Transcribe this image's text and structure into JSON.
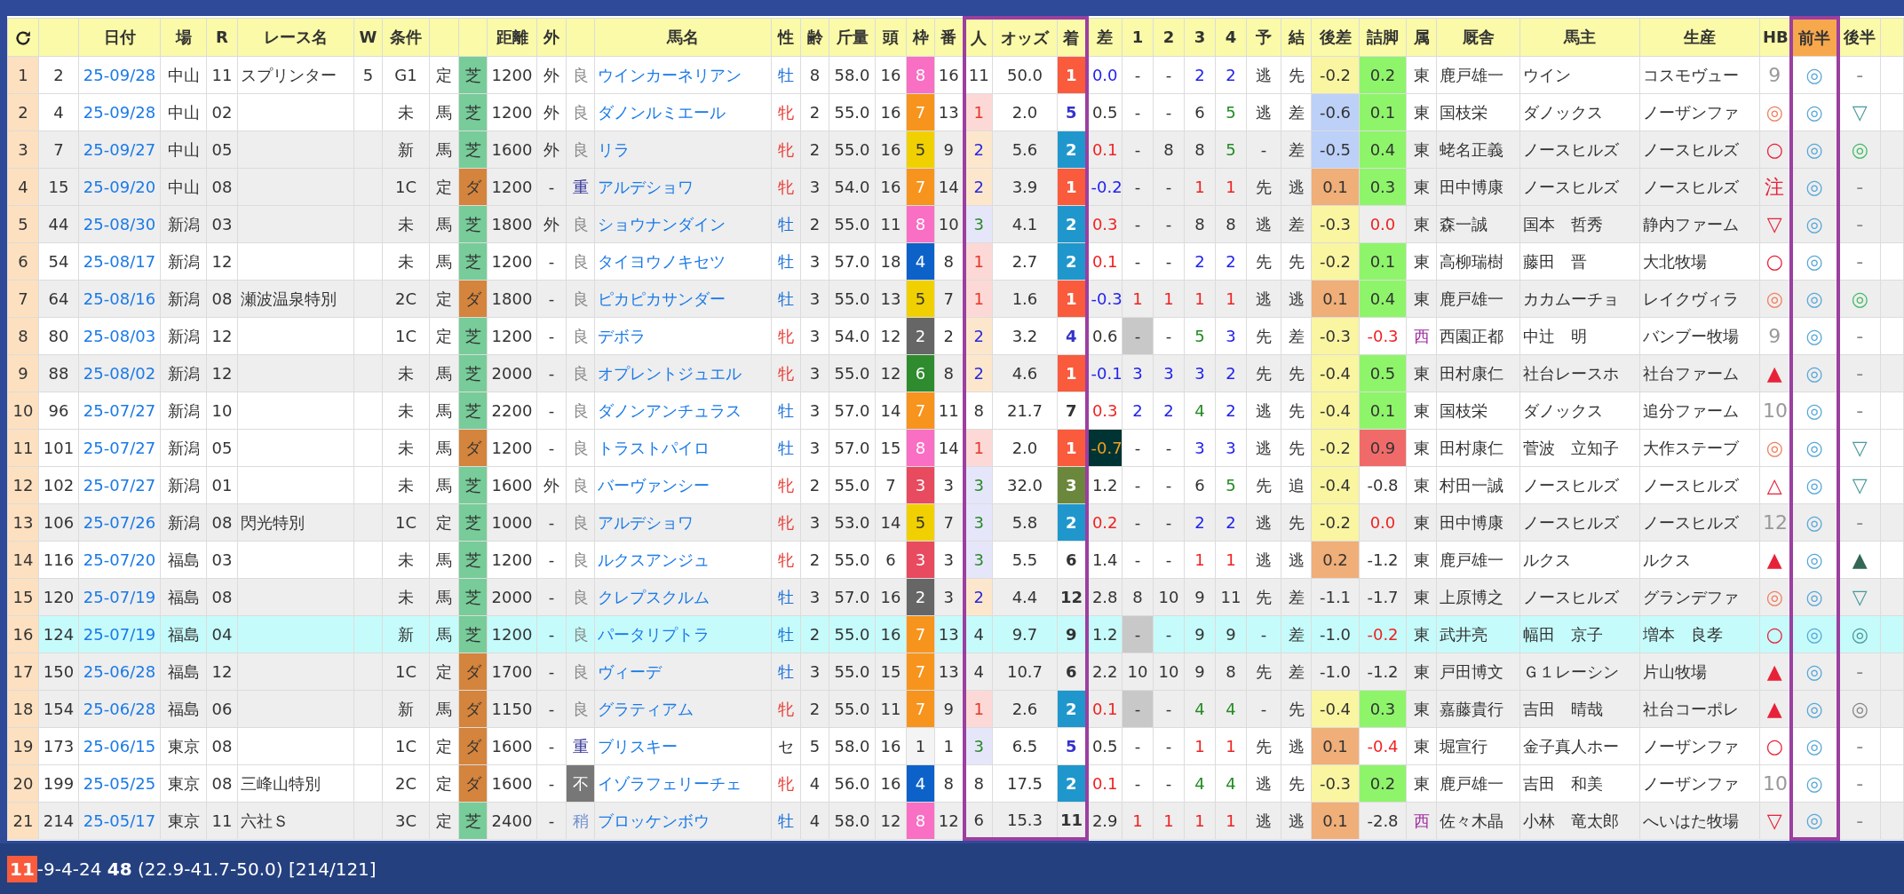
{
  "columns": [
    {
      "kind": "refresh"
    },
    {},
    {
      "label": "日付",
      "kind": "link"
    },
    {
      "label": "場"
    },
    {
      "label": "R"
    },
    {
      "label": "レース名"
    },
    {
      "label": "W"
    },
    {
      "label": "条件"
    },
    {},
    {},
    {
      "label": "距離"
    },
    {
      "label": "外"
    },
    {},
    {
      "label": "馬名",
      "kind": "link"
    },
    {
      "label": "性"
    },
    {
      "label": "齢"
    },
    {
      "label": "斤量"
    },
    {
      "label": "頭"
    },
    {
      "label": "枠"
    },
    {
      "label": "番"
    },
    {
      "label": "人",
      "framed": true
    },
    {
      "label": "オッズ",
      "framed": true
    },
    {
      "label": "着",
      "framed": true
    },
    {
      "label": "差"
    },
    {
      "label": "1"
    },
    {
      "label": "2"
    },
    {
      "label": "3"
    },
    {
      "label": "4"
    },
    {
      "label": "予"
    },
    {
      "label": "結"
    },
    {
      "label": "後差"
    },
    {
      "label": "詰脚"
    },
    {
      "label": "属"
    },
    {
      "label": "厩舎"
    },
    {
      "label": "馬主"
    },
    {
      "label": "生産"
    },
    {
      "label": "HB"
    },
    {
      "label": "前半",
      "framed": true,
      "fill": {
        "color": "#f8a84c"
      }
    },
    {
      "label": "後半"
    }
  ],
  "rows": [
    {
      "selected": false,
      "shaded": false,
      "cells": [
        "1",
        "2",
        "25-09/28",
        "中山",
        "11",
        "スプリンター",
        "5",
        "G1",
        "定",
        {
          "text": "芝",
          "fill": {
            "color": "#77cc99"
          }
        },
        "1200",
        "外",
        {
          "text": "良",
          "color": "#888888"
        },
        "ウインカーネリアン",
        {
          "text": "牡",
          "color": "#1a6fd8"
        },
        "8",
        "58.0",
        "16",
        {
          "text": "8",
          "fill": {
            "color": "#f86fc3"
          }
        },
        "16",
        "11",
        "50.0",
        {
          "text": "1",
          "fill": {
            "color": "#f95b3c"
          }
        },
        {
          "text": "0.0",
          "color": "#2222ee"
        },
        "-",
        "-",
        {
          "text": "2",
          "color": "#2222ee"
        },
        {
          "text": "2",
          "color": "#2222ee"
        },
        "逃",
        "先",
        {
          "text": "-0.2",
          "fill": {
            "color": "#faf5a0"
          }
        },
        {
          "text": "0.2",
          "fill": {
            "color": "#8ef56a"
          }
        },
        "東",
        "鹿戸雄一",
        "ウイン",
        "コスモヴュー",
        {
          "text": "9",
          "color": "#999999"
        },
        {
          "text": "◎",
          "color": "#5aa8d8"
        },
        {
          "text": "-",
          "color": "#888888"
        }
      ]
    },
    {
      "selected": false,
      "shaded": false,
      "cells": [
        "2",
        "4",
        "25-09/28",
        "中山",
        "02",
        null,
        null,
        "未",
        "馬",
        {
          "text": "芝",
          "fill": {
            "color": "#77cc99"
          }
        },
        "1200",
        "外",
        {
          "text": "良",
          "color": "#888888"
        },
        "ダノンルミエール",
        {
          "text": "牝",
          "color": "#e8413a"
        },
        "2",
        "55.0",
        "16",
        {
          "text": "7",
          "fill": {
            "color": "#f7941d"
          }
        },
        "13",
        {
          "text": "1",
          "color": "#e8332a",
          "fill": {
            "color": "#fcd9d6"
          }
        },
        "2.0",
        {
          "text": "5",
          "color": "#3333cc"
        },
        "0.5",
        "-",
        "-",
        "6",
        {
          "text": "5",
          "color": "#228b22"
        },
        "逃",
        "差",
        {
          "text": "-0.6",
          "fill": {
            "color": "#bcd0f8"
          }
        },
        {
          "text": "0.1",
          "fill": {
            "color": "#8ef56a"
          }
        },
        "東",
        "国枝栄",
        "ダノックス",
        "ノーザンファ",
        {
          "text": "◎",
          "color": "#f08060"
        },
        {
          "text": "◎",
          "color": "#5aa8d8"
        },
        {
          "text": "▽",
          "color": "#4a9a9a"
        }
      ]
    },
    {
      "selected": false,
      "shaded": true,
      "cells": [
        "3",
        "7",
        "25-09/27",
        "中山",
        "05",
        null,
        null,
        "新",
        "馬",
        {
          "text": "芝",
          "fill": {
            "color": "#77cc99"
          }
        },
        "1600",
        "外",
        {
          "text": "良",
          "color": "#888888"
        },
        "リラ",
        {
          "text": "牝",
          "color": "#e8413a"
        },
        "2",
        "55.0",
        "16",
        {
          "text": "5",
          "fill": {
            "color": "#f0d000"
          }
        },
        "9",
        {
          "text": "2",
          "color": "#2a2ae0",
          "fill": {
            "color": "#fde7cc"
          }
        },
        "5.6",
        {
          "text": "2",
          "fill": {
            "color": "#1f97cd"
          }
        },
        {
          "text": "0.1",
          "color": "#ee2222"
        },
        "-",
        "8",
        "8",
        {
          "text": "5",
          "color": "#228b22"
        },
        "-",
        "差",
        {
          "text": "-0.5",
          "fill": {
            "color": "#bcd0f8"
          }
        },
        {
          "text": "0.4",
          "fill": {
            "color": "#8ef56a"
          }
        },
        "東",
        "蛯名正義",
        "ノースヒルズ",
        "ノースヒルズ",
        {
          "text": "○",
          "color": "#e8213a"
        },
        {
          "text": "◎",
          "color": "#5aa8d8"
        },
        {
          "text": "◎",
          "color": "#44bb66"
        }
      ]
    },
    {
      "selected": false,
      "shaded": true,
      "cells": [
        "4",
        "15",
        "25-09/20",
        "中山",
        "08",
        null,
        null,
        "1C",
        "定",
        {
          "text": "ダ",
          "fill": {
            "color": "#d4843c"
          }
        },
        "1200",
        "-",
        {
          "text": "重",
          "color": "#333399"
        },
        "アルデショワ",
        {
          "text": "牝",
          "color": "#e8413a"
        },
        "3",
        "54.0",
        "16",
        {
          "text": "7",
          "fill": {
            "color": "#f7941d"
          }
        },
        "14",
        {
          "text": "2",
          "color": "#2a2ae0",
          "fill": {
            "color": "#fde7cc"
          }
        },
        "3.9",
        {
          "text": "1",
          "fill": {
            "color": "#f95b3c"
          }
        },
        {
          "text": "-0.2",
          "color": "#2222ee"
        },
        "-",
        "-",
        {
          "text": "1",
          "color": "#ee2222"
        },
        {
          "text": "1",
          "color": "#ee2222"
        },
        "先",
        "逃",
        {
          "text": "0.1",
          "fill": {
            "color": "#f0ae78"
          }
        },
        {
          "text": "0.3",
          "fill": {
            "color": "#8ef56a"
          }
        },
        "東",
        "田中博康",
        "ノースヒルズ",
        "ノースヒルズ",
        {
          "text": "注",
          "color": "#e8213a"
        },
        {
          "text": "◎",
          "color": "#5aa8d8"
        },
        {
          "text": "-",
          "color": "#888888"
        }
      ]
    },
    {
      "selected": false,
      "shaded": true,
      "cells": [
        "5",
        "44",
        "25-08/30",
        "新潟",
        "03",
        null,
        null,
        "未",
        "馬",
        {
          "text": "芝",
          "fill": {
            "color": "#77cc99"
          }
        },
        "1800",
        "外",
        {
          "text": "良",
          "color": "#888888"
        },
        "ショウナンダイン",
        {
          "text": "牡",
          "color": "#1a6fd8"
        },
        "2",
        "55.0",
        "11",
        {
          "text": "8",
          "fill": {
            "color": "#f86fc3"
          }
        },
        "10",
        {
          "text": "3",
          "color": "#2a8a2a",
          "fill": {
            "color": "#e6e6fa"
          }
        },
        "4.1",
        {
          "text": "2",
          "fill": {
            "color": "#1f97cd"
          }
        },
        {
          "text": "0.3",
          "color": "#ee2222"
        },
        "-",
        "-",
        "8",
        "8",
        "逃",
        "差",
        {
          "text": "-0.3",
          "fill": {
            "color": "#faf5a0"
          }
        },
        {
          "text": "0.0",
          "color": "#ee2222"
        },
        "東",
        "森一誠",
        "国本　哲秀",
        "静内ファーム",
        {
          "text": "▽",
          "color": "#e8213a"
        },
        {
          "text": "◎",
          "color": "#5aa8d8"
        },
        {
          "text": "-",
          "color": "#888888"
        }
      ]
    },
    {
      "selected": false,
      "shaded": false,
      "cells": [
        "6",
        "54",
        "25-08/17",
        "新潟",
        "12",
        null,
        null,
        "未",
        "馬",
        {
          "text": "芝",
          "fill": {
            "color": "#77cc99"
          }
        },
        "1200",
        "-",
        {
          "text": "良",
          "color": "#888888"
        },
        "タイヨウノキセツ",
        {
          "text": "牡",
          "color": "#1a6fd8"
        },
        "3",
        "57.0",
        "18",
        {
          "text": "4",
          "fill": {
            "color": "#0d62c9"
          }
        },
        "8",
        {
          "text": "1",
          "color": "#e8332a",
          "fill": {
            "color": "#fcd9d6"
          }
        },
        "2.7",
        {
          "text": "2",
          "fill": {
            "color": "#1f97cd"
          }
        },
        {
          "text": "0.1",
          "color": "#ee2222"
        },
        "-",
        "-",
        {
          "text": "2",
          "color": "#2222ee"
        },
        {
          "text": "2",
          "color": "#2222ee"
        },
        "先",
        "先",
        {
          "text": "-0.2",
          "fill": {
            "color": "#faf5a0"
          }
        },
        {
          "text": "0.1",
          "fill": {
            "color": "#8ef56a"
          }
        },
        "東",
        "高柳瑞樹",
        "藤田　晋",
        "大北牧場",
        {
          "text": "○",
          "color": "#e8213a"
        },
        {
          "text": "◎",
          "color": "#5aa8d8"
        },
        {
          "text": "-",
          "color": "#888888"
        }
      ]
    },
    {
      "selected": false,
      "shaded": true,
      "cells": [
        "7",
        "64",
        "25-08/16",
        "新潟",
        "08",
        "瀬波温泉特別",
        null,
        "2C",
        "定",
        {
          "text": "ダ",
          "fill": {
            "color": "#d4843c"
          }
        },
        "1800",
        "-",
        {
          "text": "良",
          "color": "#888888"
        },
        "ピカピカサンダー",
        {
          "text": "牡",
          "color": "#1a6fd8"
        },
        "3",
        "55.0",
        "13",
        {
          "text": "5",
          "fill": {
            "color": "#f0d000"
          }
        },
        "7",
        {
          "text": "1",
          "color": "#e8332a",
          "fill": {
            "color": "#fcd9d6"
          }
        },
        "1.6",
        {
          "text": "1",
          "fill": {
            "color": "#f95b3c"
          }
        },
        {
          "text": "-0.3",
          "color": "#2222ee"
        },
        {
          "text": "1",
          "color": "#ee2222"
        },
        {
          "text": "1",
          "color": "#ee2222"
        },
        {
          "text": "1",
          "color": "#ee2222"
        },
        {
          "text": "1",
          "color": "#ee2222"
        },
        "逃",
        "逃",
        {
          "text": "0.1",
          "fill": {
            "color": "#f0ae78"
          }
        },
        {
          "text": "0.4",
          "fill": {
            "color": "#8ef56a"
          }
        },
        "東",
        "鹿戸雄一",
        "カカムーチョ",
        "レイクヴィラ",
        {
          "text": "◎",
          "color": "#f08060"
        },
        {
          "text": "◎",
          "color": "#5aa8d8"
        },
        {
          "text": "◎",
          "color": "#44bb66"
        }
      ]
    },
    {
      "selected": false,
      "shaded": false,
      "cells": [
        "8",
        "80",
        "25-08/03",
        "新潟",
        "12",
        null,
        null,
        "1C",
        "定",
        {
          "text": "芝",
          "fill": {
            "color": "#77cc99"
          }
        },
        "1200",
        "-",
        {
          "text": "良",
          "color": "#888888"
        },
        "デボラ",
        {
          "text": "牝",
          "color": "#e8413a"
        },
        "3",
        "54.0",
        "12",
        {
          "text": "2",
          "fill": {
            "color": "#666666"
          }
        },
        "2",
        {
          "text": "2",
          "color": "#2a2ae0",
          "fill": {
            "color": "#fde7cc"
          }
        },
        "3.2",
        {
          "text": "4",
          "color": "#3333cc"
        },
        "0.6",
        {
          "text": "-",
          "fill": {
            "color": "#c8c8c8"
          }
        },
        "-",
        {
          "text": "5",
          "color": "#228b22"
        },
        {
          "text": "3",
          "color": "#2222ee"
        },
        "先",
        "差",
        {
          "text": "-0.3",
          "fill": {
            "color": "#faf5a0"
          }
        },
        {
          "text": "-0.3",
          "color": "#ee2222"
        },
        {
          "text": "西",
          "color": "#a030a0"
        },
        "西園正都",
        "中辻　明",
        "バンブー牧場",
        {
          "text": "9",
          "color": "#999999"
        },
        {
          "text": "◎",
          "color": "#5aa8d8"
        },
        {
          "text": "-",
          "color": "#888888"
        }
      ]
    },
    {
      "selected": false,
      "shaded": true,
      "cells": [
        "9",
        "88",
        "25-08/02",
        "新潟",
        "12",
        null,
        null,
        "未",
        "馬",
        {
          "text": "芝",
          "fill": {
            "color": "#77cc99"
          }
        },
        "2000",
        "-",
        {
          "text": "良",
          "color": "#888888"
        },
        "オプレントジュエル",
        {
          "text": "牝",
          "color": "#e8413a"
        },
        "3",
        "55.0",
        "12",
        {
          "text": "6",
          "fill": {
            "color": "#2e8b2e"
          }
        },
        "8",
        {
          "text": "2",
          "color": "#2a2ae0",
          "fill": {
            "color": "#fde7cc"
          }
        },
        "4.6",
        {
          "text": "1",
          "fill": {
            "color": "#f95b3c"
          }
        },
        {
          "text": "-0.1",
          "color": "#2222ee"
        },
        {
          "text": "3",
          "color": "#2222ee"
        },
        {
          "text": "3",
          "color": "#2222ee"
        },
        {
          "text": "3",
          "color": "#2222ee"
        },
        {
          "text": "2",
          "color": "#2222ee"
        },
        "先",
        "先",
        {
          "text": "-0.4",
          "fill": {
            "color": "#faf5a0"
          }
        },
        {
          "text": "0.5",
          "fill": {
            "color": "#8ef56a"
          }
        },
        "東",
        "田村康仁",
        "社台レースホ",
        "社台ファーム",
        {
          "text": "▲",
          "color": "#e8213a"
        },
        {
          "text": "◎",
          "color": "#5aa8d8"
        },
        {
          "text": "-",
          "color": "#888888"
        }
      ]
    },
    {
      "selected": false,
      "shaded": false,
      "cells": [
        "10",
        "96",
        "25-07/27",
        "新潟",
        "10",
        null,
        null,
        "未",
        "馬",
        {
          "text": "芝",
          "fill": {
            "color": "#77cc99"
          }
        },
        "2200",
        "-",
        {
          "text": "良",
          "color": "#888888"
        },
        "ダノンアンチュラス",
        {
          "text": "牡",
          "color": "#1a6fd8"
        },
        "3",
        "57.0",
        "14",
        {
          "text": "7",
          "fill": {
            "color": "#f7941d"
          }
        },
        "11",
        "8",
        "21.7",
        "7",
        {
          "text": "0.3",
          "color": "#ee2222"
        },
        {
          "text": "2",
          "color": "#2222ee"
        },
        {
          "text": "2",
          "color": "#2222ee"
        },
        {
          "text": "4",
          "color": "#228b22"
        },
        {
          "text": "2",
          "color": "#2222ee"
        },
        "逃",
        "先",
        {
          "text": "-0.4",
          "fill": {
            "color": "#faf5a0"
          }
        },
        {
          "text": "0.1",
          "fill": {
            "color": "#8ef56a"
          }
        },
        "東",
        "国枝栄",
        "ダノックス",
        "追分ファーム",
        {
          "text": "10",
          "color": "#999999"
        },
        {
          "text": "◎",
          "color": "#5aa8d8"
        },
        {
          "text": "-",
          "color": "#888888"
        }
      ]
    },
    {
      "selected": false,
      "shaded": false,
      "cells": [
        "11",
        "101",
        "25-07/27",
        "新潟",
        "05",
        null,
        null,
        "未",
        "馬",
        {
          "text": "ダ",
          "fill": {
            "color": "#d4843c"
          }
        },
        "1200",
        "-",
        {
          "text": "良",
          "color": "#888888"
        },
        "トラストパイロ",
        {
          "text": "牡",
          "color": "#1a6fd8"
        },
        "3",
        "57.0",
        "15",
        {
          "text": "8",
          "fill": {
            "color": "#f86fc3"
          }
        },
        "14",
        {
          "text": "1",
          "color": "#e8332a",
          "fill": {
            "color": "#fcd9d6"
          }
        },
        "2.0",
        {
          "text": "1",
          "fill": {
            "color": "#f95b3c"
          }
        },
        {
          "text": "-0.7",
          "color": "#f0a020",
          "fill": {
            "color": "#003333"
          }
        },
        "-",
        "-",
        {
          "text": "3",
          "color": "#2222ee"
        },
        {
          "text": "3",
          "color": "#2222ee"
        },
        "逃",
        "先",
        {
          "text": "-0.2",
          "fill": {
            "color": "#faf5a0"
          }
        },
        {
          "text": "0.9",
          "fill": {
            "color": "#f06a6a"
          }
        },
        "東",
        "田村康仁",
        "菅波　立知子",
        "大作ステーブ",
        {
          "text": "◎",
          "color": "#f08060"
        },
        {
          "text": "◎",
          "color": "#5aa8d8"
        },
        {
          "text": "▽",
          "color": "#4a9a9a"
        }
      ]
    },
    {
      "selected": false,
      "shaded": false,
      "cells": [
        "12",
        "102",
        "25-07/27",
        "新潟",
        "01",
        null,
        null,
        "未",
        "馬",
        {
          "text": "芝",
          "fill": {
            "color": "#77cc99"
          }
        },
        "1600",
        "外",
        {
          "text": "良",
          "color": "#888888"
        },
        "バーヴァンシー",
        {
          "text": "牝",
          "color": "#e8413a"
        },
        "2",
        "55.0",
        "7",
        {
          "text": "3",
          "fill": {
            "color": "#e84a5f"
          }
        },
        "3",
        {
          "text": "3",
          "color": "#2a8a2a",
          "fill": {
            "color": "#e6e6fa"
          }
        },
        "32.0",
        {
          "text": "3",
          "fill": {
            "color": "#6b873c"
          }
        },
        "1.2",
        "-",
        "-",
        "6",
        {
          "text": "5",
          "color": "#228b22"
        },
        "先",
        "追",
        {
          "text": "-0.4",
          "fill": {
            "color": "#faf5a0"
          }
        },
        "-0.8",
        "東",
        "村田一誠",
        "ノースヒルズ",
        "ノースヒルズ",
        {
          "text": "△",
          "color": "#e8213a"
        },
        {
          "text": "◎",
          "color": "#5aa8d8"
        },
        {
          "text": "▽",
          "color": "#4a9a9a"
        }
      ]
    },
    {
      "selected": false,
      "shaded": true,
      "cells": [
        "13",
        "106",
        "25-07/26",
        "新潟",
        "08",
        "閃光特別",
        null,
        "1C",
        "定",
        {
          "text": "芝",
          "fill": {
            "color": "#77cc99"
          }
        },
        "1000",
        "-",
        {
          "text": "良",
          "color": "#888888"
        },
        "アルデショワ",
        {
          "text": "牝",
          "color": "#e8413a"
        },
        "3",
        "53.0",
        "14",
        {
          "text": "5",
          "fill": {
            "color": "#f0d000"
          }
        },
        "7",
        {
          "text": "3",
          "color": "#2a8a2a",
          "fill": {
            "color": "#e6e6fa"
          }
        },
        "5.8",
        {
          "text": "2",
          "fill": {
            "color": "#1f97cd"
          }
        },
        {
          "text": "0.2",
          "color": "#ee2222"
        },
        "-",
        "-",
        {
          "text": "2",
          "color": "#2222ee"
        },
        {
          "text": "2",
          "color": "#2222ee"
        },
        "逃",
        "先",
        {
          "text": "-0.2",
          "fill": {
            "color": "#faf5a0"
          }
        },
        {
          "text": "0.0",
          "color": "#ee2222"
        },
        "東",
        "田中博康",
        "ノースヒルズ",
        "ノースヒルズ",
        {
          "text": "12",
          "color": "#999999"
        },
        {
          "text": "◎",
          "color": "#5aa8d8"
        },
        {
          "text": "-",
          "color": "#888888"
        }
      ]
    },
    {
      "selected": false,
      "shaded": false,
      "cells": [
        "14",
        "116",
        "25-07/20",
        "福島",
        "03",
        null,
        null,
        "未",
        "馬",
        {
          "text": "芝",
          "fill": {
            "color": "#77cc99"
          }
        },
        "1200",
        "-",
        {
          "text": "良",
          "color": "#888888"
        },
        "ルクスアンジュ",
        {
          "text": "牝",
          "color": "#e8413a"
        },
        "2",
        "55.0",
        "6",
        {
          "text": "3",
          "fill": {
            "color": "#e84a5f"
          }
        },
        "3",
        {
          "text": "3",
          "color": "#2a8a2a",
          "fill": {
            "color": "#e6e6fa"
          }
        },
        "5.5",
        "6",
        "1.4",
        "-",
        "-",
        {
          "text": "1",
          "color": "#ee2222"
        },
        {
          "text": "1",
          "color": "#ee2222"
        },
        "逃",
        "逃",
        {
          "text": "0.2",
          "fill": {
            "color": "#f0ae78"
          }
        },
        "-1.2",
        "東",
        "鹿戸雄一",
        "ルクス",
        "ルクス",
        {
          "text": "▲",
          "color": "#e8213a"
        },
        {
          "text": "◎",
          "color": "#5aa8d8"
        },
        {
          "text": "▲",
          "color": "#336655"
        }
      ]
    },
    {
      "selected": false,
      "shaded": true,
      "cells": [
        "15",
        "120",
        "25-07/19",
        "福島",
        "08",
        null,
        null,
        "未",
        "馬",
        {
          "text": "芝",
          "fill": {
            "color": "#77cc99"
          }
        },
        "2000",
        "-",
        {
          "text": "良",
          "color": "#888888"
        },
        "クレプスクルム",
        {
          "text": "牡",
          "color": "#1a6fd8"
        },
        "3",
        "57.0",
        "16",
        {
          "text": "2",
          "fill": {
            "color": "#666666"
          }
        },
        "3",
        {
          "text": "2",
          "color": "#2a2ae0",
          "fill": {
            "color": "#fde7cc"
          }
        },
        "4.4",
        "12",
        "2.8",
        "8",
        "10",
        "9",
        "11",
        "先",
        "差",
        "-1.1",
        "-1.7",
        "東",
        "上原博之",
        "ノースヒルズ",
        "グランデファ",
        {
          "text": "◎",
          "color": "#f08060"
        },
        {
          "text": "◎",
          "color": "#5aa8d8"
        },
        {
          "text": "▽",
          "color": "#4a9a9a"
        }
      ]
    },
    {
      "selected": true,
      "shaded": false,
      "cells": [
        "16",
        "124",
        "25-07/19",
        "福島",
        "04",
        null,
        null,
        "新",
        "馬",
        {
          "text": "芝",
          "fill": {
            "color": "#77cc99"
          }
        },
        "1200",
        "-",
        {
          "text": "良",
          "color": "#888888"
        },
        "パータリプトラ",
        {
          "text": "牡",
          "color": "#1a6fd8"
        },
        "2",
        "55.0",
        "16",
        {
          "text": "7",
          "fill": {
            "color": "#f7941d"
          }
        },
        "13",
        "4",
        "9.7",
        "9",
        "1.2",
        {
          "text": "-",
          "fill": {
            "color": "#c8c8c8"
          }
        },
        "-",
        "9",
        "9",
        "-",
        "差",
        "-1.0",
        {
          "text": "-0.2",
          "color": "#ee2222"
        },
        "東",
        "武井亮",
        "幅田　京子",
        "増本　良孝",
        {
          "text": "○",
          "color": "#e8213a"
        },
        {
          "text": "◎",
          "color": "#5aa8d8"
        },
        {
          "text": "◎",
          "color": "#4a9a9a"
        }
      ]
    },
    {
      "selected": false,
      "shaded": true,
      "cells": [
        "17",
        "150",
        "25-06/28",
        "福島",
        "12",
        null,
        null,
        "1C",
        "定",
        {
          "text": "ダ",
          "fill": {
            "color": "#d4843c"
          }
        },
        "1700",
        "-",
        {
          "text": "良",
          "color": "#888888"
        },
        "ヴィーデ",
        {
          "text": "牡",
          "color": "#1a6fd8"
        },
        "3",
        "55.0",
        "15",
        {
          "text": "7",
          "fill": {
            "color": "#f7941d"
          }
        },
        "13",
        "4",
        "10.7",
        "6",
        "2.2",
        "10",
        "10",
        "9",
        "8",
        "先",
        "差",
        "-1.0",
        "-1.2",
        "東",
        "戸田博文",
        "Ｇ１レーシン",
        "片山牧場",
        {
          "text": "▲",
          "color": "#e8213a"
        },
        {
          "text": "◎",
          "color": "#5aa8d8"
        },
        {
          "text": "-",
          "color": "#888888"
        }
      ]
    },
    {
      "selected": false,
      "shaded": true,
      "cells": [
        "18",
        "154",
        "25-06/28",
        "福島",
        "06",
        null,
        null,
        "新",
        "馬",
        {
          "text": "ダ",
          "fill": {
            "color": "#d4843c"
          }
        },
        "1150",
        "-",
        {
          "text": "良",
          "color": "#888888"
        },
        "グラティアム",
        {
          "text": "牝",
          "color": "#e8413a"
        },
        "2",
        "55.0",
        "11",
        {
          "text": "7",
          "fill": {
            "color": "#f7941d"
          }
        },
        "9",
        {
          "text": "1",
          "color": "#e8332a",
          "fill": {
            "color": "#fcd9d6"
          }
        },
        "2.6",
        {
          "text": "2",
          "fill": {
            "color": "#1f97cd"
          }
        },
        {
          "text": "0.1",
          "color": "#ee2222"
        },
        {
          "text": "-",
          "fill": {
            "color": "#c8c8c8"
          }
        },
        "-",
        {
          "text": "4",
          "color": "#228b22"
        },
        {
          "text": "4",
          "color": "#228b22"
        },
        "-",
        "先",
        {
          "text": "-0.4",
          "fill": {
            "color": "#faf5a0"
          }
        },
        {
          "text": "0.3",
          "fill": {
            "color": "#8ef56a"
          }
        },
        "東",
        "嘉藤貴行",
        "吉田　晴哉",
        "社台コーポレ",
        {
          "text": "▲",
          "color": "#e8213a"
        },
        {
          "text": "◎",
          "color": "#5aa8d8"
        },
        {
          "text": "◎",
          "color": "#888888"
        }
      ]
    },
    {
      "selected": false,
      "shaded": false,
      "cells": [
        "19",
        "173",
        "25-06/15",
        "東京",
        "08",
        null,
        null,
        "1C",
        "定",
        {
          "text": "ダ",
          "fill": {
            "color": "#d4843c"
          }
        },
        "1600",
        "-",
        {
          "text": "重",
          "color": "#333399"
        },
        "ブリスキー",
        "セ",
        "5",
        "58.0",
        "16",
        {
          "text": "1",
          "fill": {
            "color": "#f4f4f4"
          }
        },
        "1",
        {
          "text": "3",
          "color": "#2a8a2a",
          "fill": {
            "color": "#e6e6fa"
          }
        },
        "6.5",
        {
          "text": "5",
          "color": "#3333cc"
        },
        "0.5",
        "-",
        "-",
        {
          "text": "1",
          "color": "#ee2222"
        },
        {
          "text": "1",
          "color": "#ee2222"
        },
        "先",
        "逃",
        {
          "text": "0.1",
          "fill": {
            "color": "#f0ae78"
          }
        },
        {
          "text": "-0.4",
          "color": "#ee2222"
        },
        "東",
        "堀宣行",
        "金子真人ホー",
        "ノーザンファ",
        {
          "text": "○",
          "color": "#e8213a"
        },
        {
          "text": "◎",
          "color": "#5aa8d8"
        },
        {
          "text": "-",
          "color": "#888888"
        }
      ]
    },
    {
      "selected": false,
      "shaded": false,
      "cells": [
        "20",
        "199",
        "25-05/25",
        "東京",
        "08",
        "三峰山特別",
        null,
        "2C",
        "定",
        {
          "text": "ダ",
          "fill": {
            "color": "#d4843c"
          }
        },
        "1600",
        "-",
        {
          "text": "不",
          "fill": {
            "color": "#777777"
          }
        },
        "イゾラフェリーチェ",
        {
          "text": "牝",
          "color": "#e8413a"
        },
        "4",
        "56.0",
        "16",
        {
          "text": "4",
          "fill": {
            "color": "#0d62c9"
          }
        },
        "8",
        "8",
        "17.5",
        {
          "text": "2",
          "fill": {
            "color": "#1f97cd"
          }
        },
        {
          "text": "0.1",
          "color": "#ee2222"
        },
        "-",
        "-",
        {
          "text": "4",
          "color": "#228b22"
        },
        {
          "text": "4",
          "color": "#228b22"
        },
        "逃",
        "先",
        {
          "text": "-0.3",
          "fill": {
            "color": "#faf5a0"
          }
        },
        {
          "text": "0.2",
          "fill": {
            "color": "#8ef56a"
          }
        },
        "東",
        "鹿戸雄一",
        "吉田　和美",
        "ノーザンファ",
        {
          "text": "10",
          "color": "#999999"
        },
        {
          "text": "◎",
          "color": "#5aa8d8"
        },
        {
          "text": "-",
          "color": "#888888"
        }
      ]
    },
    {
      "selected": false,
      "shaded": true,
      "cells": [
        "21",
        "214",
        "25-05/17",
        "東京",
        "11",
        "六社Ｓ",
        null,
        "3C",
        "定",
        {
          "text": "芝",
          "fill": {
            "color": "#77cc99"
          }
        },
        "2400",
        "-",
        {
          "text": "稍",
          "color": "#7090d0"
        },
        "ブロッケンボウ",
        {
          "text": "牡",
          "color": "#1a6fd8"
        },
        "4",
        "58.0",
        "12",
        {
          "text": "8",
          "fill": {
            "color": "#f86fc3"
          }
        },
        "12",
        "6",
        "15.3",
        "11",
        "2.9",
        {
          "text": "1",
          "color": "#ee2222"
        },
        {
          "text": "1",
          "color": "#ee2222"
        },
        {
          "text": "1",
          "color": "#ee2222"
        },
        {
          "text": "1",
          "color": "#ee2222"
        },
        "逃",
        "逃",
        {
          "text": "0.1",
          "fill": {
            "color": "#f0ae78"
          }
        },
        "-2.8",
        {
          "text": "西",
          "color": "#a030a0"
        },
        "佐々木晶",
        "小林　竜太郎",
        "へいはた牧場",
        {
          "text": "▽",
          "color": "#e8213a"
        },
        {
          "text": "◎",
          "color": "#5aa8d8"
        },
        {
          "text": "-",
          "color": "#888888"
        }
      ]
    }
  ],
  "status_bar": {
    "badge": "11",
    "text": "-9-4-24 **48** (22.9-41.7-50.0) [214/121]"
  }
}
